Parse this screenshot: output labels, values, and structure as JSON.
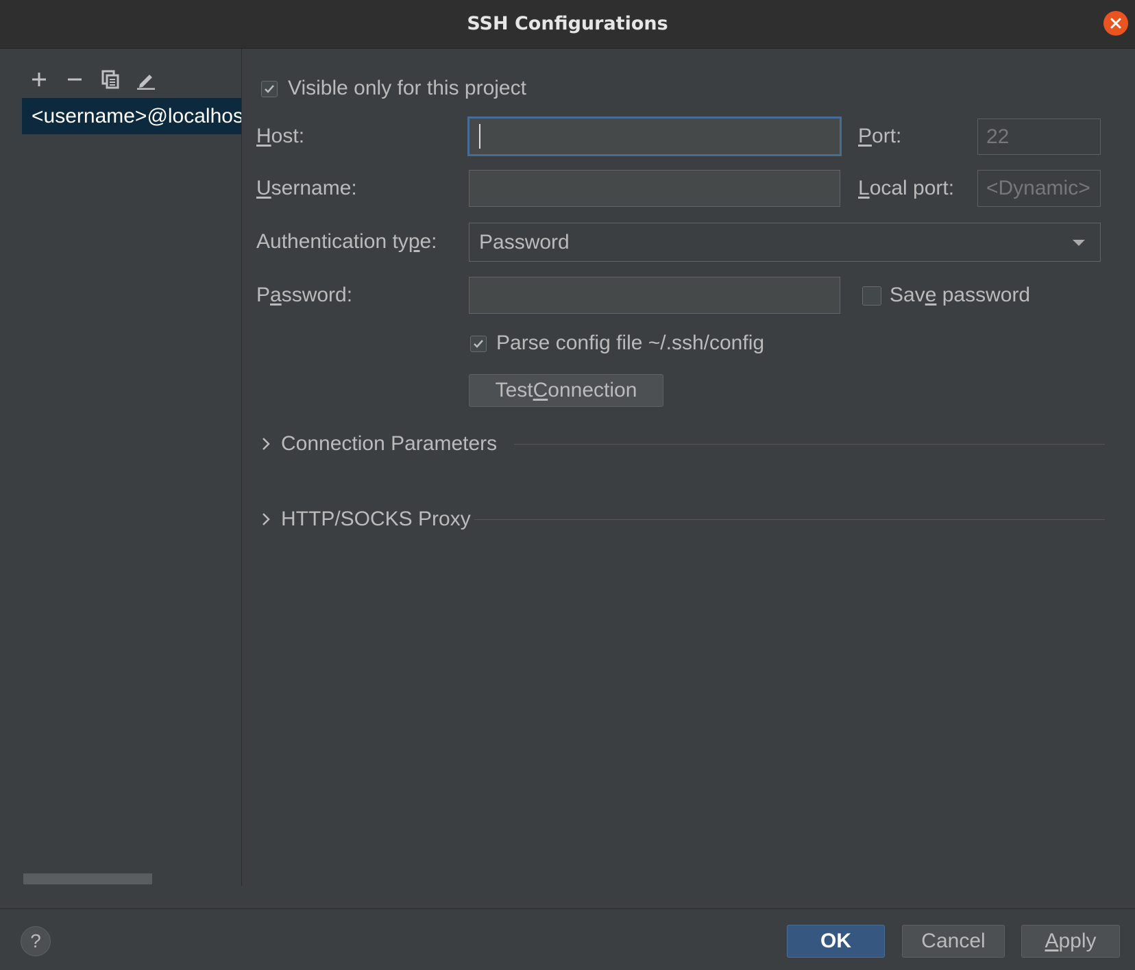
{
  "window": {
    "title": "SSH Configurations"
  },
  "sidebar": {
    "items": [
      {
        "label": "<username>@localhost"
      }
    ]
  },
  "form": {
    "visible_only": {
      "label": "Visible only for this project",
      "checked": true
    },
    "host": {
      "label_u": "H",
      "label_rest": "ost:",
      "value": ""
    },
    "port": {
      "label_u": "P",
      "label_rest": "ort:",
      "placeholder": "22"
    },
    "username": {
      "label_u": "U",
      "label_rest": "sername:",
      "value": ""
    },
    "local_port": {
      "label_u": "L",
      "label_rest": "ocal port:",
      "placeholder": "<Dynamic>"
    },
    "auth_type": {
      "label_pre": "Authentication ty",
      "label_u": "p",
      "label_rest": "e:",
      "value": "Password"
    },
    "password": {
      "label_pre": "P",
      "label_u": "a",
      "label_rest": "ssword:",
      "value": ""
    },
    "save_password": {
      "label_pre": "Sav",
      "label_u": "e",
      "label_rest": " password",
      "checked": false
    },
    "parse_config": {
      "label": "Parse config file ~/.ssh/config",
      "checked": true
    },
    "test_connection": {
      "label_pre": "Test ",
      "label_u": "C",
      "label_rest": "onnection"
    }
  },
  "sections": {
    "connection_parameters": "Connection Parameters",
    "proxy": "HTTP/SOCKS Proxy"
  },
  "footer": {
    "help": "?",
    "ok": "OK",
    "cancel": "Cancel",
    "apply_u": "A",
    "apply_rest": "pply"
  }
}
